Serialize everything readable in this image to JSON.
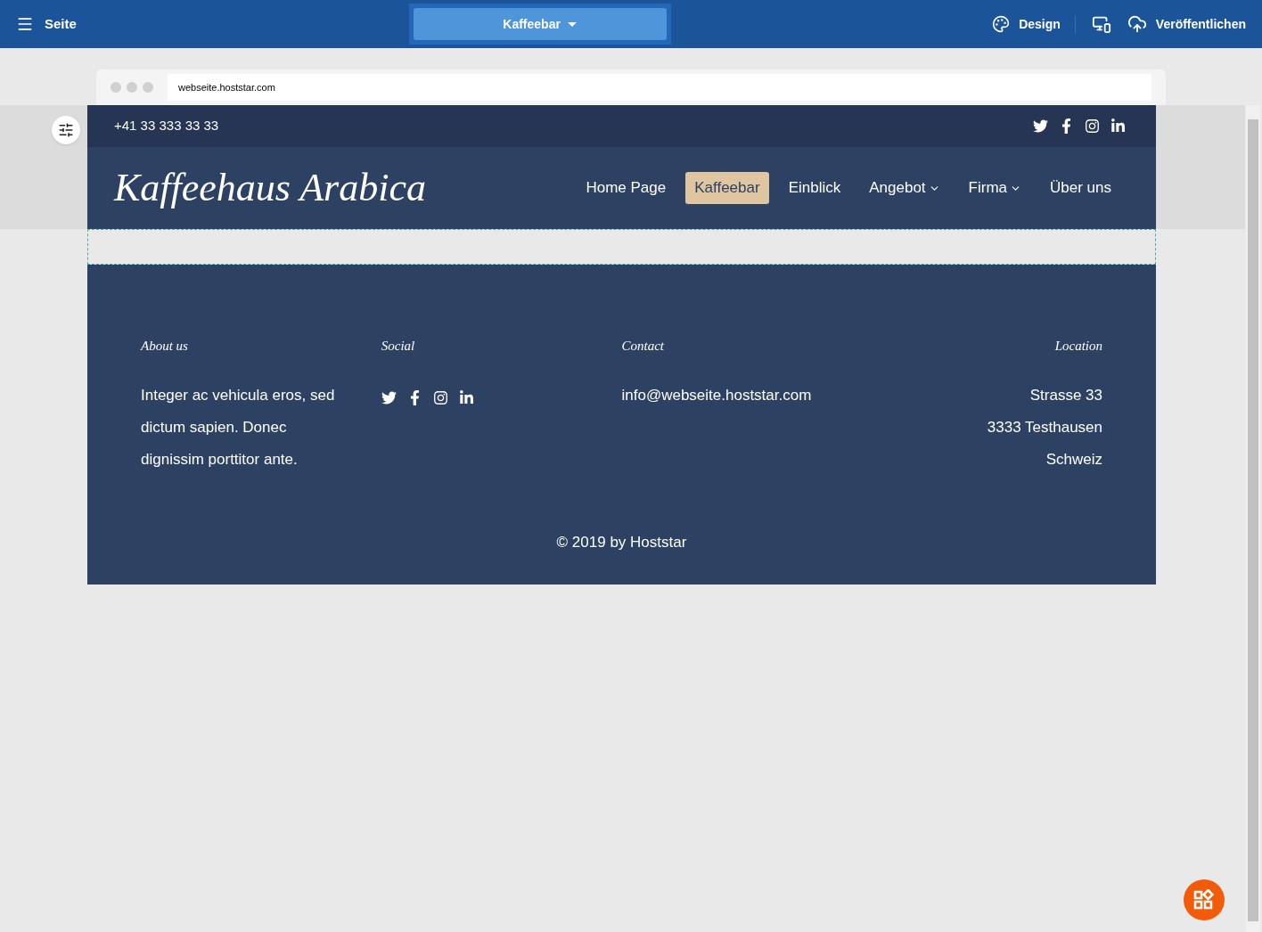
{
  "toolbar": {
    "menu_label": "Seite",
    "page_selector": "Kaffeebar",
    "design_label": "Design",
    "publish_label": "Veröffentlichen"
  },
  "browser": {
    "url": "webseite.hoststar.com"
  },
  "site": {
    "phone": "+41 33 333 33 33",
    "logo": "Kaffeehaus Arabica",
    "nav": [
      {
        "label": "Home Page",
        "selected": false,
        "kind": "link"
      },
      {
        "label": "Kaffeebar",
        "selected": true,
        "kind": "link"
      },
      {
        "label": "Einblick",
        "selected": false,
        "kind": "link"
      },
      {
        "label": "Angebot",
        "selected": false,
        "kind": "dropdown"
      },
      {
        "label": "Firma",
        "selected": false,
        "kind": "dropdown"
      },
      {
        "label": "Über uns",
        "selected": false,
        "kind": "link"
      }
    ],
    "footer": {
      "about": {
        "heading": "About us",
        "text": "Integer ac vehicula eros, sed dictum sapien. Donec dignissim porttitor ante."
      },
      "social": {
        "heading": "Social"
      },
      "contact": {
        "heading": "Contact",
        "email": "info@webseite.hoststar.com"
      },
      "location": {
        "heading": "Location",
        "lines": [
          "Strasse 33",
          "3333 Testhausen",
          "Schweiz"
        ]
      },
      "copyright": "© 2019 by Hoststar"
    }
  }
}
